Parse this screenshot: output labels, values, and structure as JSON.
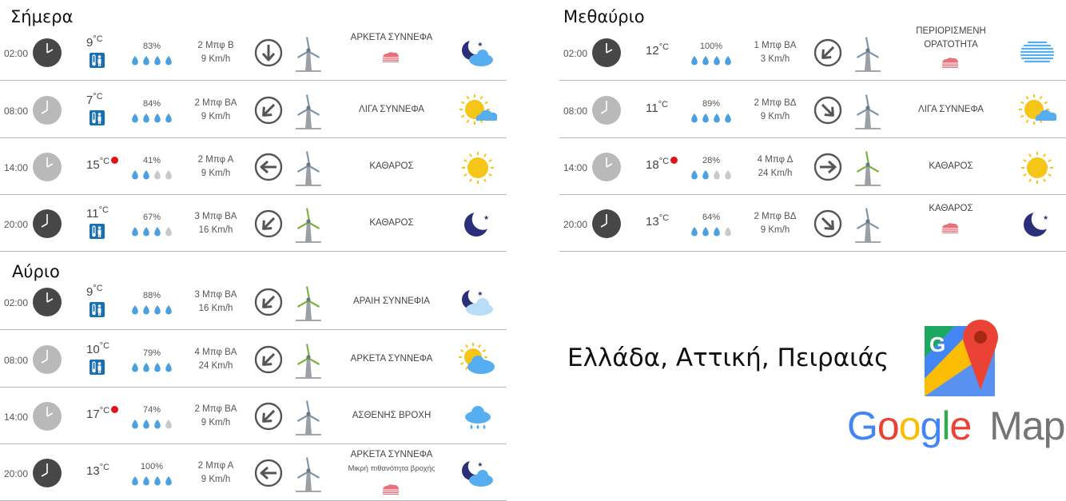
{
  "sections": [
    {
      "title": "Σήμερα",
      "rows": [
        {
          "time": "02:00",
          "clock": "dark",
          "hour": 2,
          "temp": "9",
          "unit": "°C",
          "hot": false,
          "chill": true,
          "humidity": "83%",
          "drops": 4,
          "wind_force": "2 Μπφ Β",
          "wind_speed": "9 Km/h",
          "wind_dir": "down",
          "mill": "grey",
          "condition": "ΑΡΚΕΤΑ ΣΥΝΝΕΦΑ",
          "condition_sub": "",
          "haze": true,
          "icon": "night-cloud-icon"
        },
        {
          "time": "08:00",
          "clock": "light",
          "hour": 8,
          "temp": "7",
          "unit": "°C",
          "hot": false,
          "chill": true,
          "humidity": "84%",
          "drops": 4,
          "wind_force": "2 Μπφ ΒΑ",
          "wind_speed": "9 Km/h",
          "wind_dir": "down-left",
          "mill": "grey",
          "condition": "ΛΙΓΑ ΣΥΝΝΕΦΑ",
          "condition_sub": "",
          "haze": false,
          "icon": "sun-cloud-icon"
        },
        {
          "time": "14:00",
          "clock": "light",
          "hour": 2,
          "temp": "15",
          "unit": "°C",
          "hot": true,
          "chill": false,
          "humidity": "41%",
          "drops": 2,
          "wind_force": "2 Μπφ Α",
          "wind_speed": "9 Km/h",
          "wind_dir": "left",
          "mill": "grey",
          "condition": "ΚΑΘΑΡΟΣ",
          "condition_sub": "",
          "haze": false,
          "icon": "sun-icon"
        },
        {
          "time": "20:00",
          "clock": "dark",
          "hour": 8,
          "temp": "11",
          "unit": "°C",
          "hot": false,
          "chill": true,
          "humidity": "67%",
          "drops": 3,
          "wind_force": "3 Μπφ ΒΑ",
          "wind_speed": "16 Km/h",
          "wind_dir": "down-left",
          "mill": "green",
          "condition": "ΚΑΘΑΡΟΣ",
          "condition_sub": "",
          "haze": false,
          "icon": "moon-icon"
        }
      ]
    },
    {
      "title": "Αύριο",
      "rows": [
        {
          "time": "02:00",
          "clock": "dark",
          "hour": 2,
          "temp": "9",
          "unit": "°C",
          "hot": false,
          "chill": true,
          "humidity": "88%",
          "drops": 4,
          "wind_force": "3 Μπφ ΒΑ",
          "wind_speed": "16 Km/h",
          "wind_dir": "down-left",
          "mill": "green",
          "condition": "ΑΡΑΙΗ ΣΥΝΝΕΦΙΑ",
          "condition_sub": "",
          "haze": false,
          "icon": "night-light-cloud-icon"
        },
        {
          "time": "08:00",
          "clock": "light",
          "hour": 8,
          "temp": "10",
          "unit": "°C",
          "hot": false,
          "chill": true,
          "humidity": "79%",
          "drops": 4,
          "wind_force": "4 Μπφ ΒΑ",
          "wind_speed": "24 Km/h",
          "wind_dir": "down-left",
          "mill": "green",
          "condition": "ΑΡΚΕΤΑ ΣΥΝΝΕΦΑ",
          "condition_sub": "",
          "haze": false,
          "icon": "sun-big-cloud-icon"
        },
        {
          "time": "14:00",
          "clock": "light",
          "hour": 2,
          "temp": "17",
          "unit": "°C",
          "hot": true,
          "chill": false,
          "humidity": "74%",
          "drops": 3,
          "wind_force": "2 Μπφ ΒΑ",
          "wind_speed": "9 Km/h",
          "wind_dir": "down-left",
          "mill": "grey",
          "condition": "ΑΣΘΕΝΗΣ ΒΡΟΧΗ",
          "condition_sub": "",
          "haze": false,
          "icon": "rain-icon"
        },
        {
          "time": "20:00",
          "clock": "dark",
          "hour": 8,
          "temp": "13",
          "unit": "°C",
          "hot": false,
          "chill": false,
          "humidity": "100%",
          "drops": 4,
          "wind_force": "2 Μπφ Α",
          "wind_speed": "9 Km/h",
          "wind_dir": "left",
          "mill": "grey",
          "condition": "ΑΡΚΕΤΑ ΣΥΝΝΕΦΑ",
          "condition_sub": "Μικρή πιθανότητα βροχής",
          "haze": true,
          "icon": "night-cloud-icon"
        }
      ]
    },
    {
      "title": "Μεθαύριο",
      "rows": [
        {
          "time": "02:00",
          "clock": "dark",
          "hour": 2,
          "temp": "12",
          "unit": "°C",
          "hot": false,
          "chill": false,
          "humidity": "100%",
          "drops": 4,
          "wind_force": "1 Μπφ ΒΑ",
          "wind_speed": "3 Km/h",
          "wind_dir": "down-left",
          "mill": "grey",
          "condition": "ΠΕΡΙΟΡΙΣΜΕΝΗ ΟΡΑΤΟΤΗΤΑ",
          "condition_sub": "",
          "haze": true,
          "icon": "fog-icon"
        },
        {
          "time": "08:00",
          "clock": "light",
          "hour": 8,
          "temp": "11",
          "unit": "°C",
          "hot": false,
          "chill": false,
          "humidity": "89%",
          "drops": 4,
          "wind_force": "2 Μπφ ΒΔ",
          "wind_speed": "9 Km/h",
          "wind_dir": "down-right",
          "mill": "grey",
          "condition": "ΛΙΓΑ ΣΥΝΝΕΦΑ",
          "condition_sub": "",
          "haze": false,
          "icon": "sun-cloud-icon"
        },
        {
          "time": "14:00",
          "clock": "light",
          "hour": 2,
          "temp": "18",
          "unit": "°C",
          "hot": true,
          "chill": false,
          "humidity": "28%",
          "drops": 2,
          "wind_force": "4 Μπφ Δ",
          "wind_speed": "24 Km/h",
          "wind_dir": "right",
          "mill": "green",
          "condition": "ΚΑΘΑΡΟΣ",
          "condition_sub": "",
          "haze": false,
          "icon": "sun-icon"
        },
        {
          "time": "20:00",
          "clock": "dark",
          "hour": 8,
          "temp": "13",
          "unit": "°C",
          "hot": false,
          "chill": false,
          "humidity": "64%",
          "drops": 3,
          "wind_force": "2 Μπφ ΒΔ",
          "wind_speed": "9 Km/h",
          "wind_dir": "down-right",
          "mill": "grey",
          "condition": "ΚΑΘΑΡΟΣ",
          "condition_sub": "",
          "haze": true,
          "icon": "moon-icon"
        }
      ]
    }
  ],
  "location": "Ελλάδα, Αττική, Πειραιάς",
  "maps_logo": {
    "text_google": "Google",
    "text_maps": "Maps"
  },
  "colors": {
    "drop": "#4aa0e0",
    "drop_empty": "#c9c9c9",
    "hot": "#e0151c",
    "chill": "#1a6fb0",
    "mill_grey": "#7f95a8",
    "mill_green": "#7ab23c",
    "sun": "#f5c518",
    "moon": "#2b2f7a",
    "cloud": "#56aef0",
    "haze": "#e8707a"
  }
}
